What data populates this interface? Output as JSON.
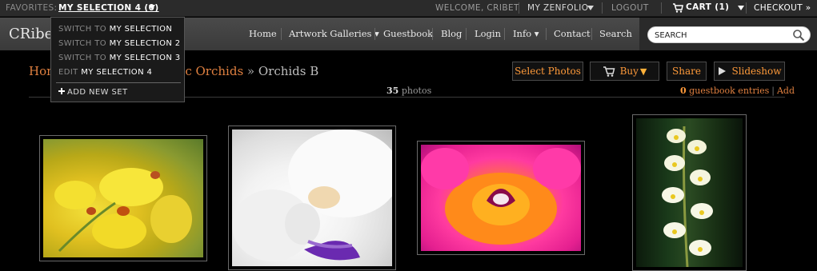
{
  "topbar": {
    "favorites_label": "FAVORITES:",
    "current_selection": "MY SELECTION 4 (0)",
    "welcome": "WELCOME, CRIBET",
    "my_zenfolio": "MY ZENFOLIO",
    "logout": "LOGOUT",
    "cart": "CART (1)",
    "checkout": "CHECKOUT »"
  },
  "favorites_menu": {
    "items": [
      {
        "prefix": "SWITCH TO",
        "name": "MY SELECTION"
      },
      {
        "prefix": "SWITCH TO",
        "name": "MY SELECTION 2"
      },
      {
        "prefix": "SWITCH TO",
        "name": "MY SELECTION 3"
      },
      {
        "prefix": "EDIT",
        "name": "MY SELECTION 4"
      }
    ],
    "add_new": "ADD NEW SET"
  },
  "header": {
    "site_title": "CRibet",
    "nav": [
      "Home",
      "Artwork Galleries ▾",
      "Guestbook",
      "Blog",
      "Login",
      "Info ▾",
      "Contact",
      "Search"
    ],
    "search_placeholder": "SEARCH"
  },
  "page": {
    "crumb_home": "Hom",
    "crumb_gallery": "c Orchids",
    "crumb_sep": " » ",
    "crumb_current": "Orchids B",
    "photo_count": "35",
    "photo_label": "photos",
    "guestbook_count": "0",
    "guestbook_label": "guestbook entries",
    "guestbook_add": "Add"
  },
  "actions": {
    "select_photos": "Select Photos",
    "buy": "Buy",
    "share": "Share",
    "slideshow": "Slideshow"
  },
  "colors": {
    "accent_orange": "#ff9a3a",
    "link_orange": "#e08040",
    "header_bg": "#404040",
    "topbar_bg": "#2b2b2b"
  }
}
